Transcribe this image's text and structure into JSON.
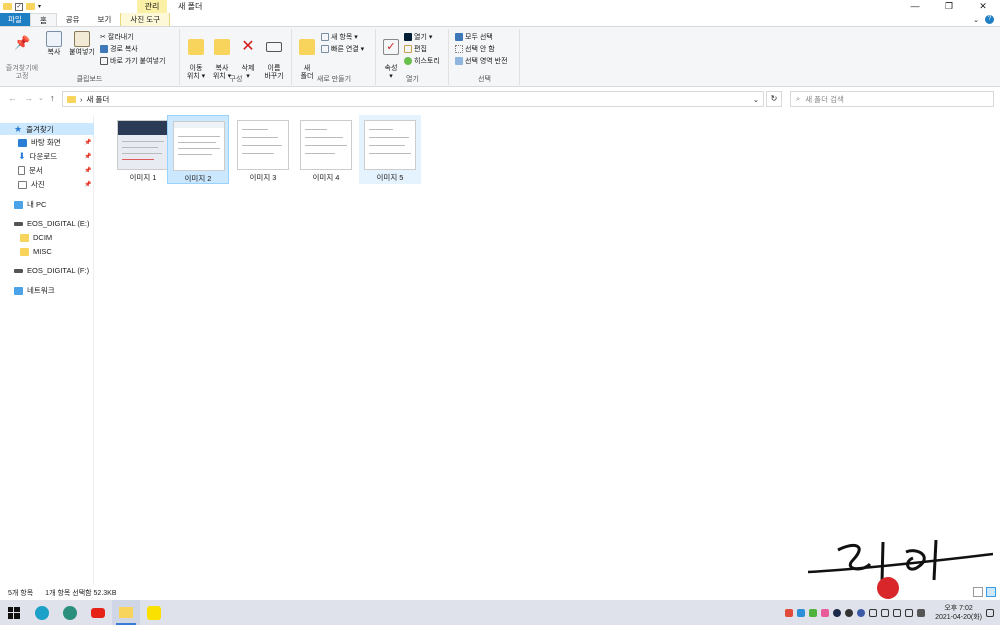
{
  "titlebar": {
    "context_tab": "관리",
    "title": "새 폴더",
    "minimize": "—",
    "restore": "❐",
    "close": "✕"
  },
  "tabs": {
    "file": "파일",
    "home": "홈",
    "share": "공유",
    "view": "보기",
    "picture_tools": "사진 도구"
  },
  "ribbon": {
    "clipboard": {
      "pin": "즐겨찾기에\n고정",
      "copy": "복사",
      "paste": "붙여넣기",
      "cut": "잘라내기",
      "copy_path": "경로 복사",
      "paste_shortcut": "바로 가기 붙여넣기",
      "label": "클립보드"
    },
    "organize": {
      "move_to": "이동\n위치 ▾",
      "copy_to": "복사\n위치 ▾",
      "delete": "삭제\n▾",
      "rename": "이름\n바꾸기",
      "label": "구성"
    },
    "new": {
      "new_folder": "새\n폴더",
      "new_item": "새 항목 ▾",
      "easy_access": "빠른 연결 ▾",
      "label": "새로 만들기"
    },
    "open": {
      "properties": "속성\n▾",
      "open": "열기 ▾",
      "edit": "편집",
      "history": "히스토리",
      "label": "열기"
    },
    "select": {
      "select_all": "모두 선택",
      "select_none": "선택 안 함",
      "invert": "선택 영역 반전",
      "label": "선택"
    }
  },
  "address": {
    "path_sep": "›",
    "path": "새 폴더",
    "search_placeholder": "새 폴더 검색"
  },
  "nav": {
    "quick_access": "즐겨찾기",
    "desktop": "바탕 화면",
    "downloads": "다운로드",
    "documents": "문서",
    "pictures": "사진",
    "this_pc": "내 PC",
    "eos_e": "EOS_DIGITAL (E:)",
    "dcim": "DCIM",
    "misc": "MISC",
    "eos_f": "EOS_DIGITAL (F:)",
    "network": "네트워크"
  },
  "files": [
    {
      "name": "이미지 1"
    },
    {
      "name": "이미지 2"
    },
    {
      "name": "이미지 3"
    },
    {
      "name": "이미지 4"
    },
    {
      "name": "이미지 5"
    }
  ],
  "status": {
    "count": "5개 항목",
    "selection": "1개 항목 선택함 52.3KB"
  },
  "taskbar": {
    "time": "오후 7:02",
    "date": "2021-04-20(화)"
  },
  "colors": {
    "accent": "#1f7fc5",
    "selection": "#cce8ff",
    "folder": "#f8d45c"
  }
}
